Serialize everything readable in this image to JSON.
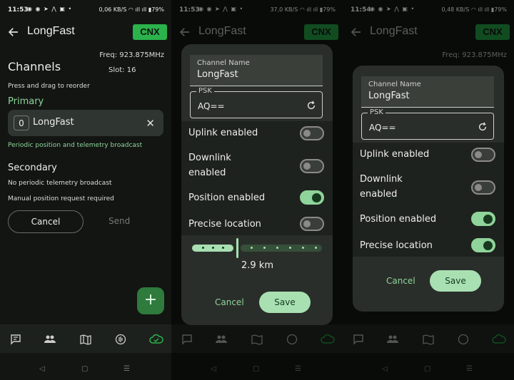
{
  "status": [
    {
      "time": "11:53",
      "net": "0,06 KB/S",
      "battery": "79%"
    },
    {
      "time": "11:53",
      "net": "37,0 KB/S",
      "battery": "79%"
    },
    {
      "time": "11:54",
      "net": "0,48 KB/S",
      "battery": "79%"
    }
  ],
  "appbar": {
    "title": "LongFast",
    "cnx": "CNX"
  },
  "channels": {
    "freq": "Freq: 923.875MHz",
    "freq_alt": "Freq: 923.875MHz",
    "slot": "Slot: 16",
    "heading": "Channels",
    "reorder_hint": "Press and drag to reorder",
    "primary_label": "Primary",
    "primary_index": "0",
    "primary_name": "LongFast",
    "primary_note": "Periodic position and telemetry broadcast",
    "secondary_label": "Secondary",
    "secondary_note1": "No periodic telemetry broadcast",
    "secondary_note2": "Manual position request required",
    "cancel": "Cancel",
    "send": "Send",
    "fab": "+"
  },
  "dialog": {
    "name_label": "Channel Name",
    "name_value": "LongFast",
    "psk_label": "PSK",
    "psk_value": "AQ==",
    "uplink": "Uplink enabled",
    "downlink_1": "Downlink",
    "downlink_2": "enabled",
    "position": "Position enabled",
    "precise": "Precise location",
    "precision_value": "2.9 km",
    "cancel": "Cancel",
    "save": "Save"
  },
  "switches_dialog1": {
    "uplink": false,
    "downlink": false,
    "position": true,
    "precise": false
  },
  "switches_dialog2": {
    "uplink": false,
    "downlink": false,
    "position": true,
    "precise": true
  },
  "colors": {
    "accent": "#8fd49a",
    "cnx_green": "#2bb24c",
    "background": "#121512",
    "dialog": "#2a2e2a"
  },
  "nav_icons": [
    "messages-icon",
    "nodes-icon",
    "map-icon",
    "channels-icon",
    "cloud-connected-icon"
  ]
}
